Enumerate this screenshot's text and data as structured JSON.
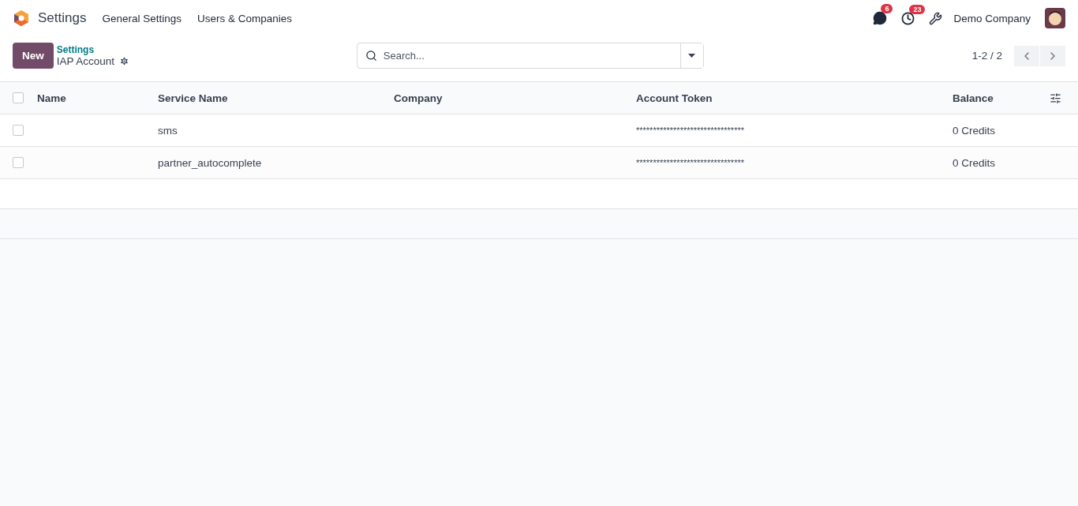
{
  "navbar": {
    "app_name": "Settings",
    "menu": [
      "General Settings",
      "Users & Companies"
    ],
    "messages_count": "6",
    "activities_count": "23",
    "company": "Demo Company"
  },
  "control_panel": {
    "new_button": "New",
    "breadcrumb": "Settings",
    "title": "IAP Account",
    "search": {
      "placeholder": "Search..."
    },
    "pager": "1-2 / 2"
  },
  "table": {
    "columns": [
      "Name",
      "Service Name",
      "Company",
      "Account Token",
      "Balance"
    ],
    "select_all_checked": false,
    "rows": [
      {
        "checked": false,
        "name": "",
        "service_name": "sms",
        "company": "",
        "account_token": "********************************",
        "balance": "0 Credits"
      },
      {
        "checked": false,
        "name": "",
        "service_name": "partner_autocomplete",
        "company": "",
        "account_token": "********************************",
        "balance": "0 Credits"
      }
    ]
  }
}
